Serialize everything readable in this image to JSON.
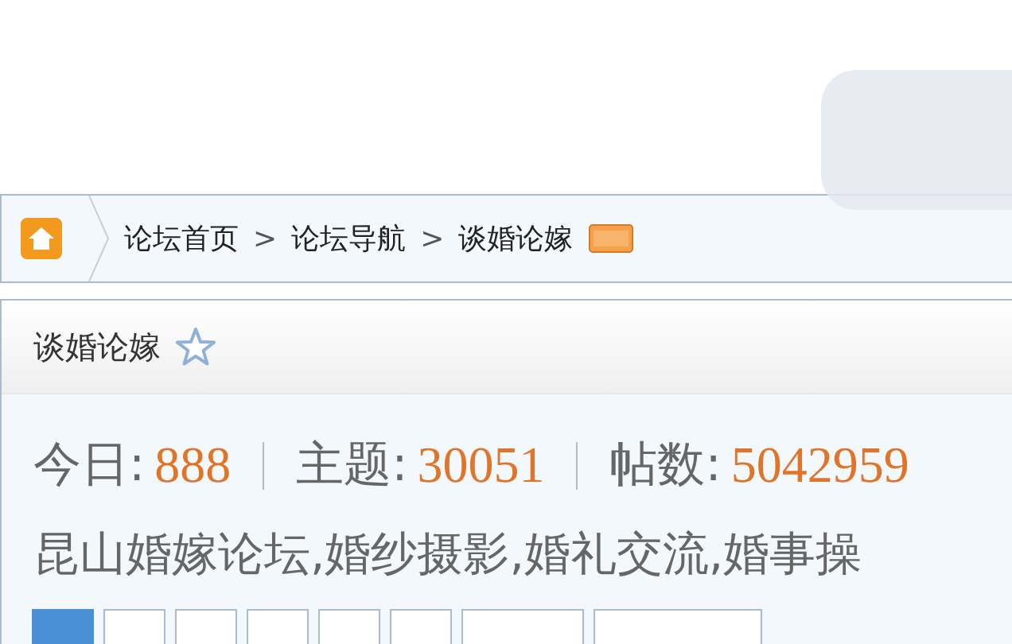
{
  "breadcrumb": {
    "items": [
      "论坛首页",
      "论坛导航",
      "谈婚论嫁"
    ],
    "separator": ">"
  },
  "forum": {
    "title": "谈婚论嫁",
    "favorited": false,
    "stats": [
      {
        "label": "今日:",
        "value": "888"
      },
      {
        "label": "主题:",
        "value": "30051"
      },
      {
        "label": "帖数:",
        "value": "5042959"
      }
    ],
    "description": "昆山婚嫁论坛,婚纱摄影,婚礼交流,婚事操"
  },
  "page_tabs": [
    {
      "selected": true,
      "kind": "small"
    },
    {
      "selected": false,
      "kind": "small"
    },
    {
      "selected": false,
      "kind": "small"
    },
    {
      "selected": false,
      "kind": "small"
    },
    {
      "selected": false,
      "kind": "small"
    },
    {
      "selected": false,
      "kind": "small"
    },
    {
      "selected": false,
      "kind": "medium"
    },
    {
      "selected": false,
      "kind": "wide"
    }
  ]
}
